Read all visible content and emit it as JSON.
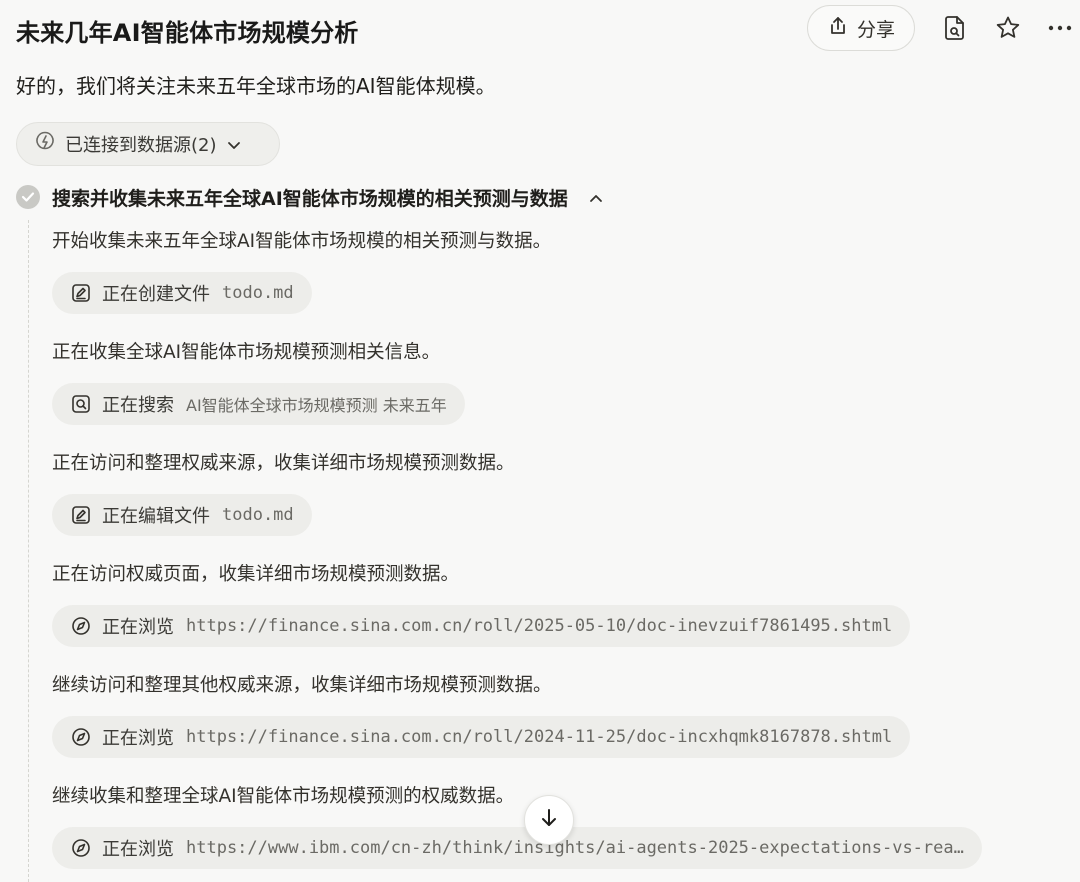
{
  "header": {
    "title": "未来几年AI智能体市场规模分析",
    "share_label": "分享",
    "icons": [
      "share-icon",
      "file-icon",
      "star-icon",
      "more-icon"
    ]
  },
  "intro": "好的，我们将关注未来五年全球市场的AI智能体规模。",
  "sources": {
    "label": "已连接到数据源(2)"
  },
  "step": {
    "title": "搜索并收集未来五年全球AI智能体市场规模的相关预测与数据",
    "items": [
      {
        "kind": "text",
        "text": "开始收集未来五年全球AI智能体市场规模的相关预测与数据。"
      },
      {
        "kind": "chip",
        "icon": "edit-icon",
        "action": "正在创建文件",
        "arg": "todo.md"
      },
      {
        "kind": "text",
        "text": "正在收集全球AI智能体市场规模预测相关信息。"
      },
      {
        "kind": "chip",
        "icon": "search-icon",
        "action": "正在搜索",
        "arg": "AI智能体全球市场规模预测 未来五年"
      },
      {
        "kind": "text",
        "text": "正在访问和整理权威来源，收集详细市场规模预测数据。"
      },
      {
        "kind": "chip",
        "icon": "edit-icon",
        "action": "正在编辑文件",
        "arg": "todo.md"
      },
      {
        "kind": "text",
        "text": "正在访问权威页面，收集详细市场规模预测数据。"
      },
      {
        "kind": "chip",
        "icon": "browser-icon",
        "action": "正在浏览",
        "arg": "https://finance.sina.com.cn/roll/2025-05-10/doc-inevzuif7861495.shtml"
      },
      {
        "kind": "text",
        "text": "继续访问和整理其他权威来源，收集详细市场规模预测数据。"
      },
      {
        "kind": "chip",
        "icon": "browser-icon",
        "action": "正在浏览",
        "arg": "https://finance.sina.com.cn/roll/2024-11-25/doc-incxhqmk8167878.shtml"
      },
      {
        "kind": "text",
        "text": "继续收集和整理全球AI智能体市场规模预测的权威数据。"
      },
      {
        "kind": "chip",
        "icon": "browser-icon",
        "action": "正在浏览",
        "arg": "https://www.ibm.com/cn-zh/think/insights/ai-agents-2025-expectations-vs-rea…"
      }
    ]
  },
  "colors": {
    "background": "#f8f8f7",
    "chip": "#ededea",
    "text": "#34322d"
  }
}
